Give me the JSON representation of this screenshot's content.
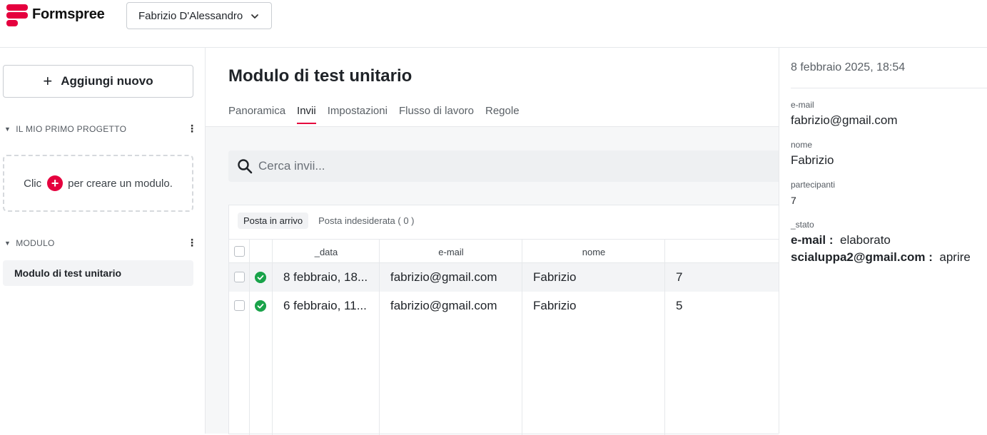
{
  "header": {
    "brand": "Formspree",
    "account": "Fabrizio D'Alessandro"
  },
  "sidebar": {
    "add_new": "Aggiungi nuovo",
    "project_section": "IL MIO PRIMO PROGETTO",
    "empty_before": "Clic",
    "empty_after": "per creare un modulo.",
    "form_section": "MODULO",
    "form_item": "Modulo di test unitario"
  },
  "main": {
    "title": "Modulo di test unitario",
    "tabs": [
      "Panoramica",
      "Invii",
      "Impostazioni",
      "Flusso di lavoro",
      "Regole"
    ],
    "active_tab": "Invii",
    "search_placeholder": "Cerca invii...",
    "subtabs": [
      "Posta in arrivo",
      "Posta indesiderata ( 0 )"
    ],
    "columns": [
      "_data",
      "e-mail",
      "nome"
    ],
    "rows": [
      {
        "date": "8 febbraio, 18...",
        "email": "fabrizio@gmail.com",
        "nome": "Fabrizio",
        "partecipanti": "7"
      },
      {
        "date": "6 febbraio, 11...",
        "email": "fabrizio@gmail.com",
        "nome": "Fabrizio",
        "partecipanti": "5"
      }
    ]
  },
  "detail": {
    "date": "8 febbraio 2025, 18:54",
    "fields": [
      {
        "label": "e-mail",
        "value": "fabrizio@gmail.com"
      },
      {
        "label": "nome",
        "value": "Fabrizio"
      },
      {
        "label": "partecipanti",
        "value": "7"
      }
    ],
    "stato_label": "_stato",
    "stato": [
      {
        "key": "e-mail :",
        "value": "elaborato"
      },
      {
        "key": "scialuppa2@gmail.com :",
        "value": "aprire"
      }
    ]
  },
  "colors": {
    "brand_red": "#e5003e",
    "success_green": "#1aa34a"
  }
}
